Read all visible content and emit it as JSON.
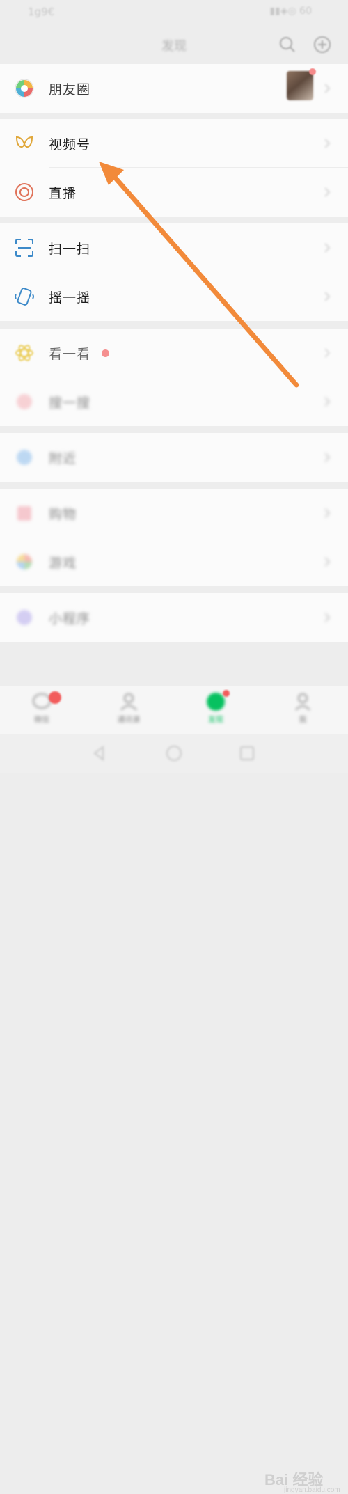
{
  "status": {
    "left": "1g9€",
    "right": "▮▮◈◎ 60"
  },
  "header": {
    "title": "发现",
    "search_icon": "search-icon",
    "plus_icon": "plus-circle-icon"
  },
  "groups": [
    {
      "items": [
        {
          "label": "朋友圈",
          "icon": "moments-icon"
        }
      ]
    },
    {
      "items": [
        {
          "label": "视频号",
          "icon": "channels-icon"
        },
        {
          "label": "直播",
          "icon": "live-icon"
        }
      ]
    },
    {
      "items": [
        {
          "label": "扫一扫",
          "icon": "scan-icon"
        },
        {
          "label": "摇一摇",
          "icon": "shake-icon"
        }
      ]
    },
    {
      "items": [
        {
          "label": "看一看",
          "icon": "top-stories-icon"
        },
        {
          "label": "搜一搜",
          "icon": "search-icon"
        }
      ]
    },
    {
      "items": [
        {
          "label": "附近",
          "icon": "nearby-icon"
        }
      ]
    },
    {
      "items": [
        {
          "label": "购物",
          "icon": "shopping-icon"
        },
        {
          "label": "游戏",
          "icon": "games-icon"
        }
      ]
    },
    {
      "items": [
        {
          "label": "小程序",
          "icon": "mini-programs-icon"
        }
      ]
    }
  ],
  "tabbar": [
    {
      "label": "微信",
      "icon": "chats-icon"
    },
    {
      "label": "通讯录",
      "icon": "contacts-icon"
    },
    {
      "label": "发现",
      "icon": "discover-icon"
    },
    {
      "label": "我",
      "icon": "me-icon"
    }
  ],
  "watermark": {
    "text": "Bai 经验",
    "sub": "jingyan.baidu.com"
  },
  "colors": {
    "accent": "#07c160",
    "arrow": "#f28a3a",
    "badge": "#f25c5c"
  }
}
